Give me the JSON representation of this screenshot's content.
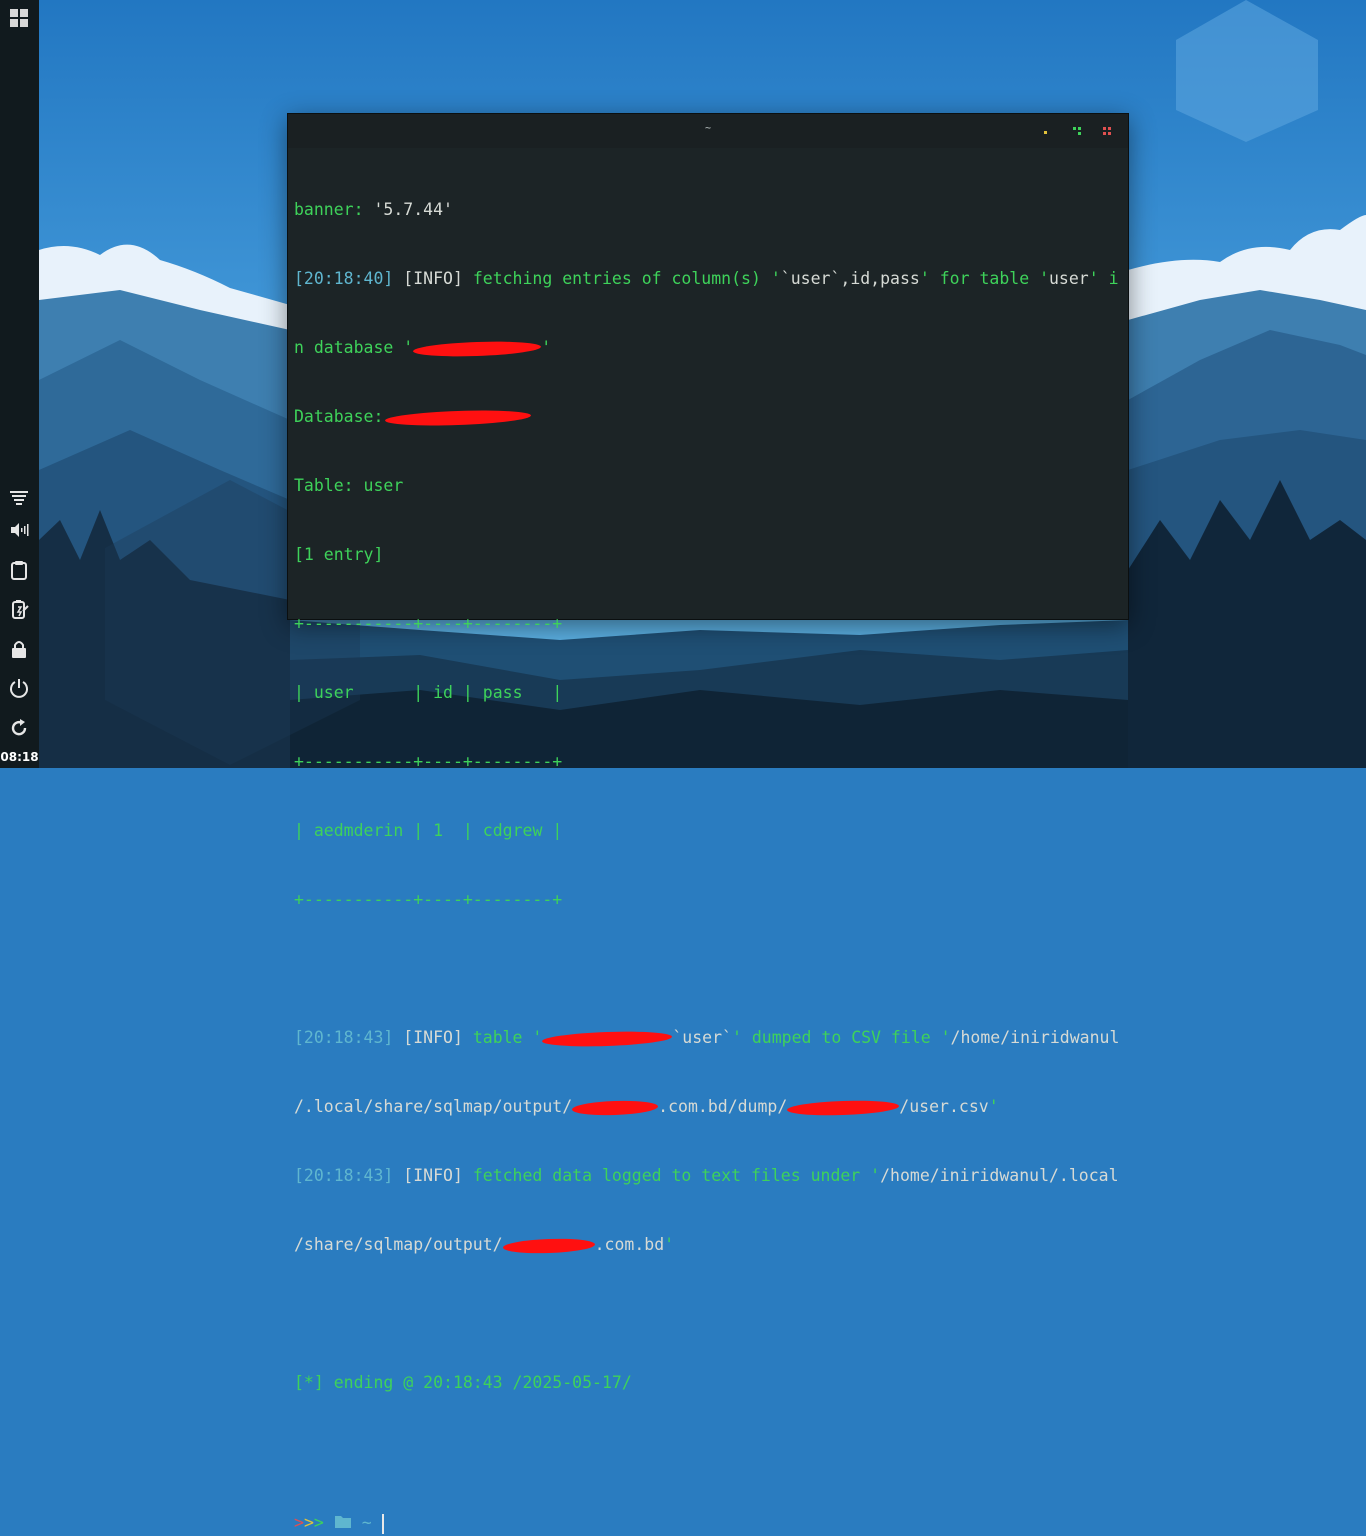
{
  "panel": {
    "clock": "08:18",
    "icons": [
      "apps-grid-icon",
      "notifications-icon",
      "volume-icon",
      "clipboard-icon",
      "battery-icon",
      "lock-icon",
      "power-icon",
      "restart-icon"
    ]
  },
  "terminal": {
    "title": "~",
    "lines": {
      "l1a": "banner: ",
      "l1b": "'5.7.44'",
      "l2ts": "[20:18:40]",
      "l2info": " [INFO]",
      "l2a": " fetching entries of column(s) '",
      "l2b": "`user`,id,pass",
      "l2c": "' for table '",
      "l2d": "user",
      "l2e": "' i",
      "l3a": "n database '",
      "l3b": "'",
      "l4a": "Database: ",
      "l5": "Table: user",
      "l6": "[1 entry]",
      "sep": "+-----------+----+--------+",
      "hdr_a": "| ",
      "hdr_user": "user",
      "hdr_b": "      | ",
      "hdr_id": "id",
      "hdr_c": " | ",
      "hdr_pass": "pass",
      "hdr_d": "   |",
      "row_a": "| ",
      "row_user": "aedmderin",
      "row_b": " | ",
      "row_id": "1",
      "row_c": "  | ",
      "row_pass": "cdgrew",
      "row_d": " |",
      "l12ts": "[20:18:43]",
      "l12info": " [INFO]",
      "l12a": " table '",
      "l12b": "`user`",
      "l12c": "' dumped to CSV file '",
      "l12d": "/home/iniridwanul",
      "l13a": "/.local/share/sqlmap/output/",
      "l13b": ".com.bd/dump/",
      "l13c": "/user.csv",
      "l13d": "'",
      "l14ts": "[20:18:43]",
      "l14info": " [INFO]",
      "l14a": " fetched data logged to text files under '",
      "l14b": "/home/iniridwanul/.local",
      "l15a": "/share/sqlmap/output/",
      "l15b": ".com.bd",
      "l15c": "'",
      "l17": "[*] ending @ 20:18:43 /2025-05-17/",
      "prompt_arrows": ">>>",
      "prompt_dir": "~"
    }
  },
  "colors": {
    "green": "#3ed25a",
    "timestamp": "#5fb6cf",
    "text": "#d6dad5",
    "terminal_bg": "#1c2426",
    "panel_bg": "#111a1e"
  }
}
